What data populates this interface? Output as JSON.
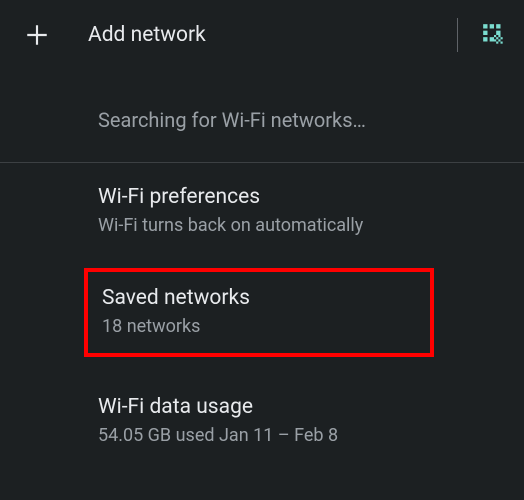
{
  "header": {
    "add_label": "Add network"
  },
  "searching": {
    "text": "Searching for Wi-Fi networks…"
  },
  "items": [
    {
      "title": "Wi-Fi preferences",
      "subtitle": "Wi-Fi turns back on automatically"
    },
    {
      "title": "Saved networks",
      "subtitle": "18 networks"
    },
    {
      "title": "Wi-Fi data usage",
      "subtitle": "54.05 GB used Jan 11 – Feb 8"
    }
  ]
}
